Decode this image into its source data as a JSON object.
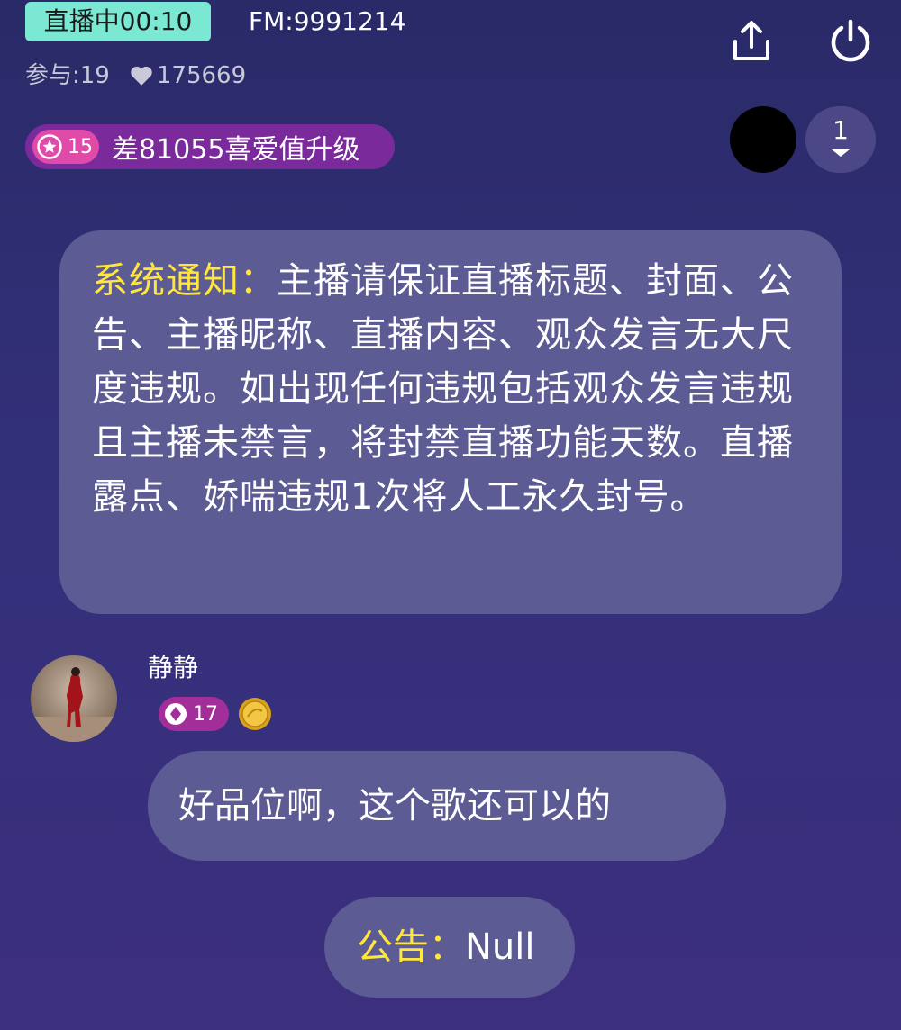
{
  "header": {
    "live_status": "直播中00:10",
    "fm": "FM:9991214",
    "participants": "参与:19",
    "likes": "175669",
    "share_icon": "share-icon",
    "power_icon": "power-icon"
  },
  "level": {
    "level": "15",
    "upgrade_text": "差81055喜爱值升级"
  },
  "online_count": "1",
  "notice": {
    "label": "系统通知：",
    "text": "主播请保证直播标题、封面、公告、主播昵称、直播内容、观众发言无大尺度违规。如出现任何违规包括观众发言违规且主播未禁言，将封禁直播功能天数。直播露点、娇喘违规1次将人工永久封号。"
  },
  "chat": [
    {
      "username": "静静",
      "vip_level": "17",
      "message": "好品位啊，这个歌还可以的"
    }
  ],
  "announcement": {
    "label": "公告：",
    "value": "Null"
  },
  "colors": {
    "live_badge": "#7be8d3",
    "highlight": "#ffe63b",
    "bubble": "#5c5b94"
  }
}
